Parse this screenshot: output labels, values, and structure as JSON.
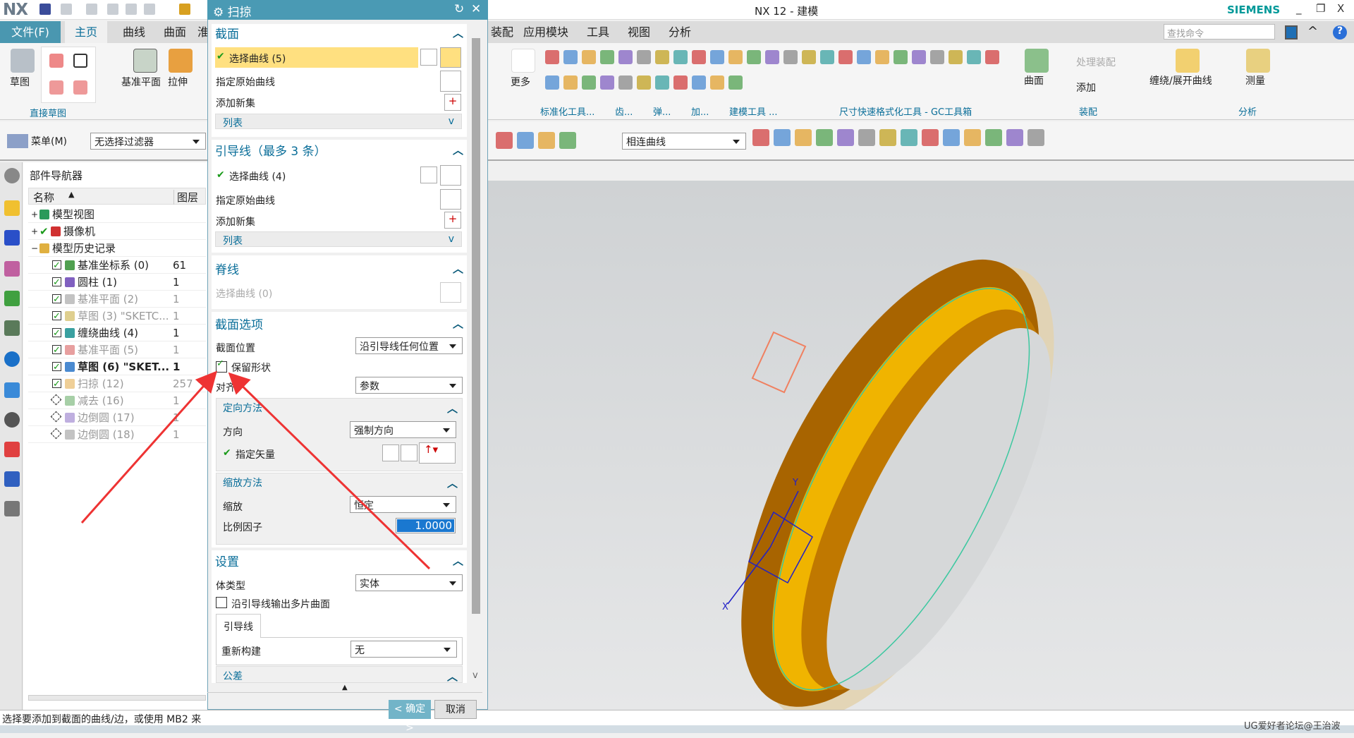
{
  "app": {
    "logo": "NX",
    "title": "NX 12 - 建模",
    "brand": "SIEMENS",
    "minimize": "_",
    "restore": "❐",
    "close": "X"
  },
  "menu": {
    "tabs_left": [
      "文件(F)",
      "主页",
      "曲线",
      "曲面",
      "淮"
    ],
    "tabs_right": [
      "装配",
      "应用模块",
      "工具",
      "视图",
      "分析"
    ],
    "search_placeholder": "查找命令"
  },
  "ribbon": {
    "sketch": "草图",
    "direct_sketch": "直接草图",
    "datum_plane": "基准平面",
    "extrude": "拉伸",
    "more": "更多",
    "groups": [
      "标准化工具...",
      "齿...",
      "弹...",
      "加...",
      "建模工具 ...",
      "尺寸快速格式化工具 - GC工具箱",
      "装配",
      "分析"
    ],
    "surface": "曲面",
    "process_assembly": "处理装配",
    "add": "添加",
    "wrap_unwrap": "缠绕/展开曲线",
    "measure": "测量",
    "icons": [
      "part-icon",
      "gear-icon",
      "spring-icon",
      "check-icon",
      "triangle-icon",
      "dimension-icon",
      "tolerance-icon",
      "assembly-icon",
      "layer-icon",
      "edit-icon",
      "note-icon",
      "cut-icon",
      "plane-icon",
      "measure-icon"
    ]
  },
  "toolbar": {
    "menu": "菜单(M)",
    "filter": "无选择过滤器",
    "curve_rule": "相连曲线",
    "icons": [
      "select-icon",
      "rect-select-icon",
      "curve-face-icon",
      "cube-icon",
      "intersection-icon",
      "tangent-icon",
      "snap-icon",
      "datum-icon",
      "arrow-icon",
      "point-icon",
      "line-icon",
      "spline-icon",
      "circle-icon",
      "grid-icon",
      "zoom-icon",
      "rotate-icon",
      "shade-icon",
      "view-icon"
    ]
  },
  "navigator": {
    "title": "部件导航器",
    "col_name": "名称",
    "col_layer": "图层",
    "rows": [
      {
        "label": "模型视图",
        "layer": "",
        "style": "normal",
        "level": 0,
        "check": "none"
      },
      {
        "label": "摄像机",
        "layer": "",
        "style": "normal",
        "level": 0,
        "check": "tick"
      },
      {
        "label": "模型历史记录",
        "layer": "",
        "style": "normal",
        "level": 0,
        "check": "none"
      },
      {
        "label": "基准坐标系 (0)",
        "layer": "61",
        "style": "normal",
        "level": 1,
        "check": "on"
      },
      {
        "label": "圆柱 (1)",
        "layer": "1",
        "style": "normal",
        "level": 1,
        "check": "on"
      },
      {
        "label": "基准平面 (2)",
        "layer": "1",
        "style": "gray",
        "level": 1,
        "check": "on"
      },
      {
        "label": "草图 (3) \"SKETC...",
        "layer": "1",
        "style": "gray",
        "level": 1,
        "check": "on"
      },
      {
        "label": "缠绕曲线 (4)",
        "layer": "1",
        "style": "normal",
        "level": 1,
        "check": "on"
      },
      {
        "label": "基准平面 (5)",
        "layer": "1",
        "style": "gray",
        "level": 1,
        "check": "on"
      },
      {
        "label": "草图 (6) \"SKET...",
        "layer": "1",
        "style": "bold",
        "level": 1,
        "check": "on"
      },
      {
        "label": "扫掠 (12)",
        "layer": "257",
        "style": "gray",
        "level": 1,
        "check": "on"
      },
      {
        "label": "减去 (16)",
        "layer": "1",
        "style": "gray",
        "level": 1,
        "check": "dash"
      },
      {
        "label": "边倒圆 (17)",
        "layer": "1",
        "style": "gray",
        "level": 1,
        "check": "dash"
      },
      {
        "label": "边倒圆 (18)",
        "layer": "1",
        "style": "gray",
        "level": 1,
        "check": "dash"
      }
    ]
  },
  "dialog": {
    "title": "扫掠",
    "section": {
      "header": "截面",
      "select": "选择曲线 (5)",
      "origin": "指定原始曲线",
      "add_set": "添加新集",
      "list": "列表"
    },
    "guide": {
      "header": "引导线（最多 3 条）",
      "select": "选择曲线 (4)",
      "origin": "指定原始曲线",
      "add_set": "添加新集",
      "list": "列表"
    },
    "spine": {
      "header": "脊线",
      "select": "选择曲线 (0)"
    },
    "options": {
      "header": "截面选项",
      "position_label": "截面位置",
      "position_value": "沿引导线任何位置",
      "preserve_shape": "保留形状",
      "preserve_checked": true,
      "align_label": "对齐",
      "align_value": "参数",
      "orientation": {
        "header": "定向方法",
        "dir_label": "方向",
        "dir_value": "强制方向",
        "vector_label": "指定矢量"
      },
      "scaling": {
        "header": "缩放方法",
        "scale_label": "缩放",
        "scale_value": "恒定",
        "factor_label": "比例因子",
        "factor_value": "1.0000"
      }
    },
    "settings": {
      "header": "设置",
      "body_label": "体类型",
      "body_value": "实体",
      "multi_label": "沿引导线输出多片曲面",
      "multi_checked": false,
      "tab": "引导线",
      "rebuild_label": "重新构建",
      "rebuild_value": "无",
      "tolerance": "公差"
    },
    "ok": "< 确定 >",
    "cancel": "取消"
  },
  "status": "选择要添加到截面的曲线/边，或使用 MB2 来",
  "watermark": "UG爱好者论坛@王治波",
  "colors": {
    "accent": "#4a9ab4",
    "highlight": "#ffe080",
    "ring": "#f0b400",
    "ring_dark": "#a86400",
    "ring_shell": "#e0cfa8",
    "arrow": "#ee3333"
  }
}
